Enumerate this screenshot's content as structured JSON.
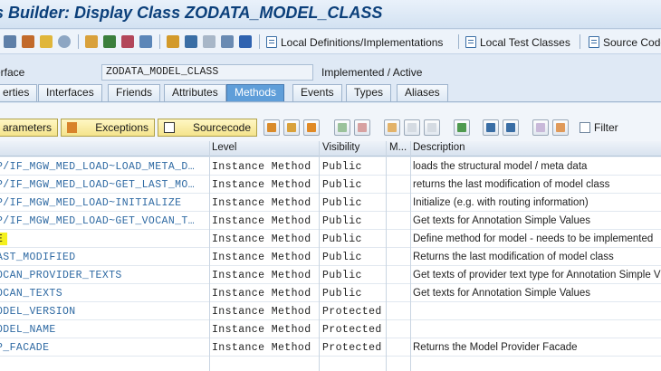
{
  "window": {
    "title": "s Builder: Display Class ZODATA_MODEL_CLASS"
  },
  "toolbar": {
    "local_defs_label": "Local Definitions/Implementations",
    "local_test_label": "Local Test Classes",
    "source_code_label": "Source Code"
  },
  "header": {
    "field_label": "erface",
    "class_name": "ZODATA_MODEL_CLASS",
    "status": "Implemented / Active"
  },
  "tabs": [
    "erties",
    "Interfaces",
    "Friends",
    "Attributes",
    "Methods",
    "Events",
    "Types",
    "Aliases"
  ],
  "active_tab": "Methods",
  "subtoolbar": {
    "parameters_label": "arameters",
    "exceptions_label": "Exceptions",
    "sourcecode_label": "Sourcecode",
    "filter_label": "Filter",
    "filter_checked": false
  },
  "grid": {
    "headers": {
      "level": "Level",
      "visibility": "Visibility",
      "m": "M...",
      "description": "Description"
    },
    "rows": [
      {
        "name": "P/IF_MGW_MED_LOAD~LOAD_META_D…",
        "level": "Instance Method",
        "visibility": "Public",
        "description": "loads the structural model / meta data"
      },
      {
        "name": "P/IF_MGW_MED_LOAD~GET_LAST_MO…",
        "level": "Instance Method",
        "visibility": "Public",
        "description": "returns the last modification of model class"
      },
      {
        "name": "P/IF_MGW_MED_LOAD~INITIALIZE",
        "level": "Instance Method",
        "visibility": "Public",
        "description": "Initialize (e.g. with routing information)"
      },
      {
        "name": "P/IF_MGW_MED_LOAD~GET_VOCAN_T…",
        "level": "Instance Method",
        "visibility": "Public",
        "description": "Get texts for Annotation Simple Values"
      },
      {
        "name": "E",
        "level": "Instance Method",
        "visibility": "Public",
        "description": "Define method for model - needs to be implemented",
        "highlight": true
      },
      {
        "name": "AST_MODIFIED",
        "level": "Instance Method",
        "visibility": "Public",
        "description": "Returns the last modification of model class"
      },
      {
        "name": "OCAN_PROVIDER_TEXTS",
        "level": "Instance Method",
        "visibility": "Public",
        "description": "Get texts of provider text type for Annotation Simple V"
      },
      {
        "name": "OCAN_TEXTS",
        "level": "Instance Method",
        "visibility": "Public",
        "description": "Get texts for Annotation Simple Values"
      },
      {
        "name": "ODEL_VERSION",
        "level": "Instance Method",
        "visibility": "Protected",
        "description": ""
      },
      {
        "name": "ODEL_NAME",
        "level": "Instance Method",
        "visibility": "Protected",
        "description": ""
      },
      {
        "name": "P_FACADE",
        "level": "Instance Method",
        "visibility": "Protected",
        "description": "Returns the Model Provider Facade"
      },
      {
        "name": "",
        "level": "",
        "visibility": "",
        "description": ""
      }
    ]
  },
  "colors": {
    "accent": "#5f9ed9",
    "method_name": "#2f6aa3",
    "highlight": "#f4f01e",
    "title": "#0b3f7a"
  }
}
